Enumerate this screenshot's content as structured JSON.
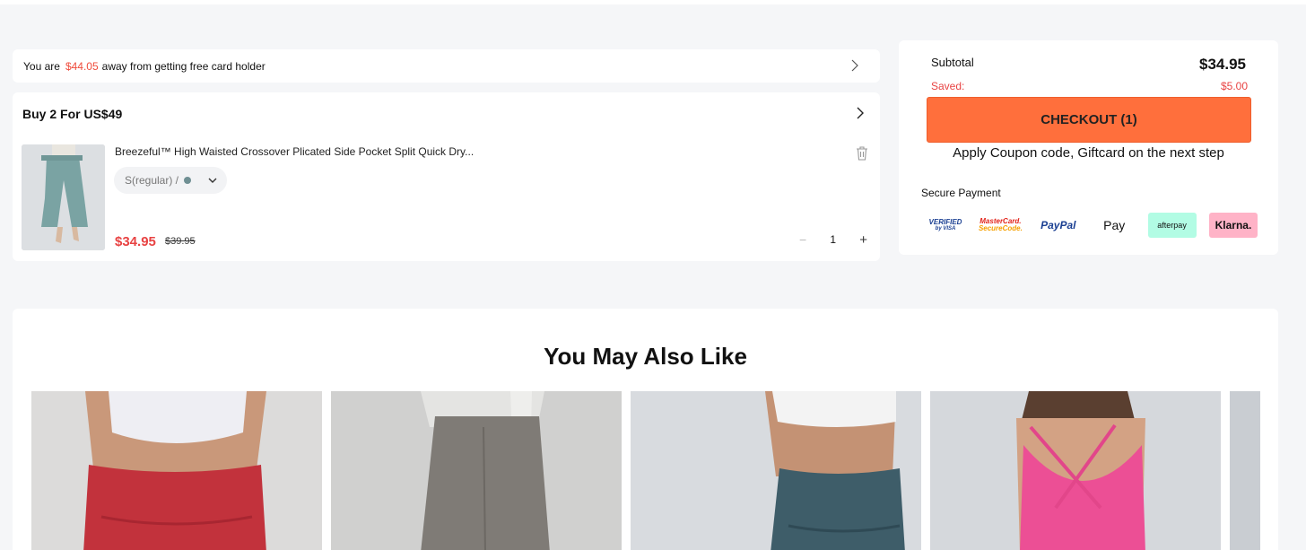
{
  "banner": {
    "prefix": "You are",
    "amount": "$44.05",
    "suffix": "away from getting free card holder"
  },
  "cart": {
    "promo_title": "Buy 2 For US$49",
    "item": {
      "name": "Breezeful™ High Waisted Crossover Plicated Side Pocket Split Quick Dry...",
      "variant": "S(regular) /",
      "swatch_color": "#6f8f93",
      "price": "$34.95",
      "original_price": "$39.95",
      "quantity": "1"
    }
  },
  "summary": {
    "subtotal_label": "Subtotal",
    "subtotal_value": "$34.95",
    "saved_label": "Saved:",
    "saved_value": "$5.00",
    "checkout_label": "CHECKOUT (1)",
    "coupon_note": "Apply Coupon code, Giftcard on the next step",
    "secure_label": "Secure Payment",
    "payment_methods": [
      "Verified by VISA",
      "MasterCard SecureCode",
      "PayPal",
      "Apple Pay",
      "afterpay",
      "Klarna."
    ]
  },
  "recommendations": {
    "title": "You May Also Like"
  },
  "colors": {
    "accent": "#ff6f3c",
    "price_red": "#e84343",
    "banner_amount": "#ef4c3c"
  }
}
